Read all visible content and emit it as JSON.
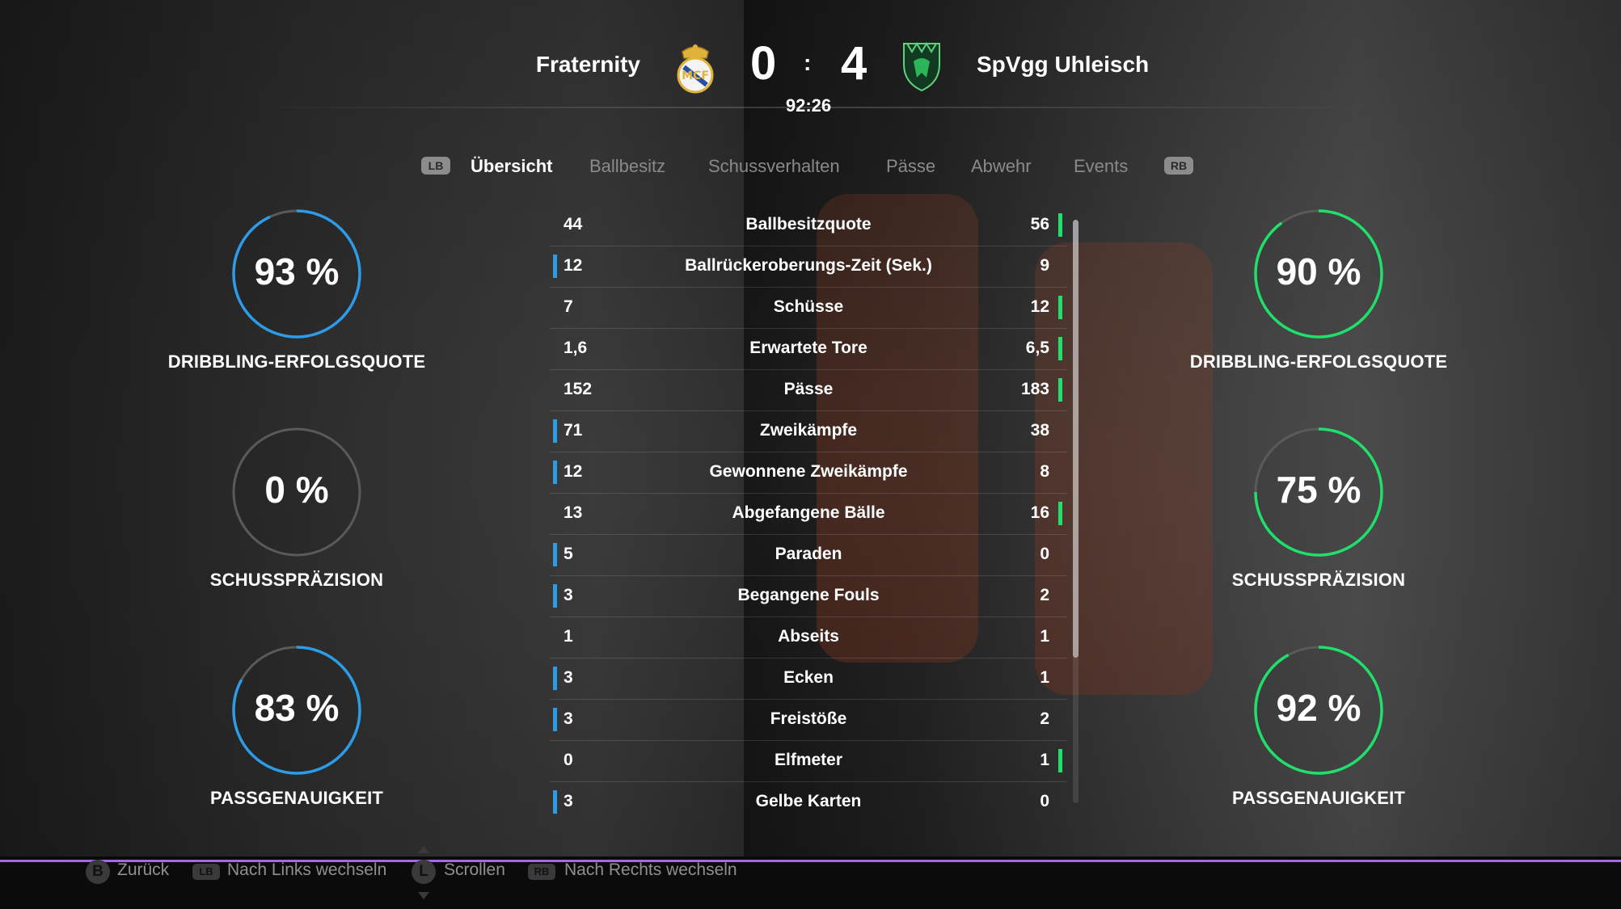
{
  "match": {
    "home_team": "Fraternity",
    "away_team": "SpVgg Uhleisch",
    "home_score": "0",
    "away_score": "4",
    "separator": ":",
    "clock": "92:26"
  },
  "tabs": {
    "lb_hint": "LB",
    "rb_hint": "RB",
    "items": [
      "Übersicht",
      "Ballbesitz",
      "Schussverhalten",
      "Pässe",
      "Abwehr",
      "Events"
    ],
    "active": "Übersicht"
  },
  "gauges": {
    "home": [
      {
        "value": "93 %",
        "label": "DRIBBLING-ERFOLGSQUOTE",
        "fraction": 0.93
      },
      {
        "value": "0 %",
        "label": "SCHUSSPRÄZISION",
        "fraction": 0.0
      },
      {
        "value": "83 %",
        "label": "PASSGENAUIGKEIT",
        "fraction": 0.83
      }
    ],
    "away": [
      {
        "value": "90 %",
        "label": "DRIBBLING-ERFOLGSQUOTE",
        "fraction": 0.9
      },
      {
        "value": "75 %",
        "label": "SCHUSSPRÄZISION",
        "fraction": 0.75
      },
      {
        "value": "92 %",
        "label": "PASSGENAUIGKEIT",
        "fraction": 0.92
      }
    ],
    "colors": {
      "home": "#2d9ce8",
      "away": "#1fe06a",
      "track": "#5a5a5a"
    }
  },
  "stats": [
    {
      "name": "Ballbesitzquote",
      "home": "44",
      "away": "56",
      "leader": "away"
    },
    {
      "name": "Ballrückeroberungs-Zeit (Sek.)",
      "home": "12",
      "away": "9",
      "leader": "home"
    },
    {
      "name": "Schüsse",
      "home": "7",
      "away": "12",
      "leader": "away"
    },
    {
      "name": "Erwartete Tore",
      "home": "1,6",
      "away": "6,5",
      "leader": "away"
    },
    {
      "name": "Pässe",
      "home": "152",
      "away": "183",
      "leader": "away"
    },
    {
      "name": "Zweikämpfe",
      "home": "71",
      "away": "38",
      "leader": "home"
    },
    {
      "name": "Gewonnene Zweikämpfe",
      "home": "12",
      "away": "8",
      "leader": "home"
    },
    {
      "name": "Abgefangene Bälle",
      "home": "13",
      "away": "16",
      "leader": "away"
    },
    {
      "name": "Paraden",
      "home": "5",
      "away": "0",
      "leader": "home"
    },
    {
      "name": "Begangene Fouls",
      "home": "3",
      "away": "2",
      "leader": "home"
    },
    {
      "name": "Abseits",
      "home": "1",
      "away": "1",
      "leader": "none"
    },
    {
      "name": "Ecken",
      "home": "3",
      "away": "1",
      "leader": "home"
    },
    {
      "name": "Freistöße",
      "home": "3",
      "away": "2",
      "leader": "home"
    },
    {
      "name": "Elfmeter",
      "home": "0",
      "away": "1",
      "leader": "away"
    },
    {
      "name": "Gelbe Karten",
      "home": "3",
      "away": "0",
      "leader": "home"
    }
  ],
  "footer": {
    "back_key": "B",
    "back": "Zurück",
    "left_key": "LB",
    "left": "Nach Links wechseln",
    "scroll_key": "L",
    "scroll": "Scrollen",
    "right_key": "RB",
    "right": "Nach Rechts wechseln"
  },
  "icons": {
    "home_crest": "real-madrid-crest-icon",
    "away_crest": "green-shield-crest-icon"
  }
}
